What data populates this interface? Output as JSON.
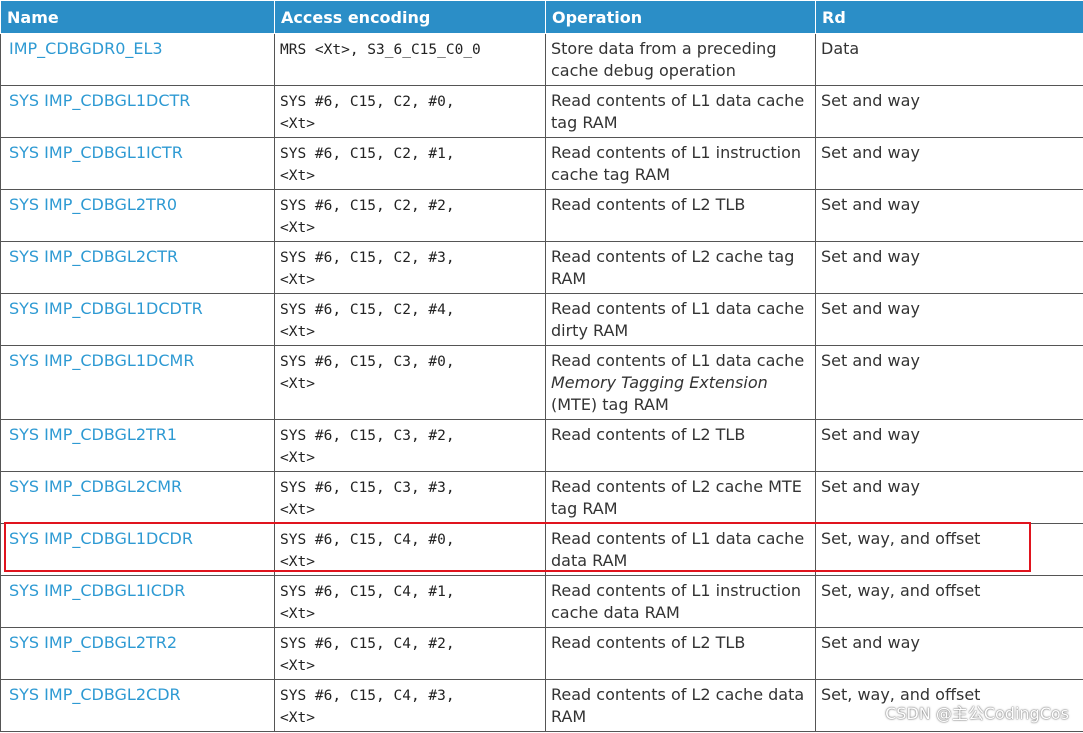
{
  "headers": {
    "name": "Name",
    "encoding": "Access encoding",
    "operation": "Operation",
    "rd": "Rd"
  },
  "rows": [
    {
      "name": "IMP_CDBGDR0_EL3",
      "enc1": "MRS <Xt>, S3_6_C15_C0_0",
      "enc2": "",
      "op": "Store data from a preceding cache debug operation",
      "rd": "Data"
    },
    {
      "name": "SYS IMP_CDBGL1DCTR",
      "enc1": "SYS #6, C15, C2, #0,",
      "enc2": "<Xt>",
      "op": "Read contents of L1 data cache tag RAM",
      "rd": "Set and way"
    },
    {
      "name": "SYS IMP_CDBGL1ICTR",
      "enc1": "SYS #6, C15, C2, #1,",
      "enc2": "<Xt>",
      "op": "Read contents of L1 instruction cache tag RAM",
      "rd": "Set and way"
    },
    {
      "name": "SYS IMP_CDBGL2TR0",
      "enc1": "SYS #6, C15, C2, #2,",
      "enc2": "<Xt>",
      "op": "Read contents of L2 TLB",
      "rd": "Set and way"
    },
    {
      "name": "SYS IMP_CDBGL2CTR",
      "enc1": "SYS #6, C15, C2, #3,",
      "enc2": "<Xt>",
      "op": "Read contents of L2 cache tag RAM",
      "rd": "Set and way"
    },
    {
      "name": "SYS IMP_CDBGL1DCDTR",
      "enc1": "SYS #6, C15, C2, #4,",
      "enc2": "<Xt>",
      "op": "Read contents of L1 data cache dirty RAM",
      "rd": "Set and way"
    },
    {
      "name": "SYS IMP_CDBGL1DCMR",
      "enc1": "SYS #6, C15, C3, #0,",
      "enc2": "<Xt>",
      "op_pre": "Read contents of L1 data cache ",
      "op_it": "Memory Tagging Extension",
      "op_post": " (MTE) tag RAM",
      "rd": "Set and way"
    },
    {
      "name": "SYS IMP_CDBGL2TR1",
      "enc1": "SYS #6, C15, C3, #2,",
      "enc2": "<Xt>",
      "op": "Read contents of L2 TLB",
      "rd": "Set and way"
    },
    {
      "name": "SYS IMP_CDBGL2CMR",
      "enc1": "SYS #6, C15, C3, #3,",
      "enc2": "<Xt>",
      "op": "Read contents of L2 cache MTE tag RAM",
      "rd": "Set and way"
    },
    {
      "name": "SYS IMP_CDBGL1DCDR",
      "enc1": "SYS #6, C15, C4, #0,",
      "enc2": "<Xt>",
      "op": "Read contents of L1 data cache data RAM",
      "rd": "Set, way, and offset"
    },
    {
      "name": "SYS IMP_CDBGL1ICDR",
      "enc1": "SYS #6, C15, C4, #1,",
      "enc2": "<Xt>",
      "op": "Read contents of L1 instruction cache data RAM",
      "rd": "Set, way, and offset"
    },
    {
      "name": "SYS IMP_CDBGL2TR2",
      "enc1": "SYS #6, C15, C4, #2,",
      "enc2": "<Xt>",
      "op": "Read contents of L2 TLB",
      "rd": "Set and way"
    },
    {
      "name": "SYS IMP_CDBGL2CDR",
      "enc1": "SYS #6, C15, C4, #3,",
      "enc2": "<Xt>",
      "op": "Read contents of L2 cache data RAM",
      "rd": "Set, way, and offset"
    }
  ],
  "watermark": "CSDN @主公CodingCos",
  "colors": {
    "header_bg": "#2b8ec7",
    "name_link": "#2e9ad3",
    "highlight": "#e0141e"
  }
}
